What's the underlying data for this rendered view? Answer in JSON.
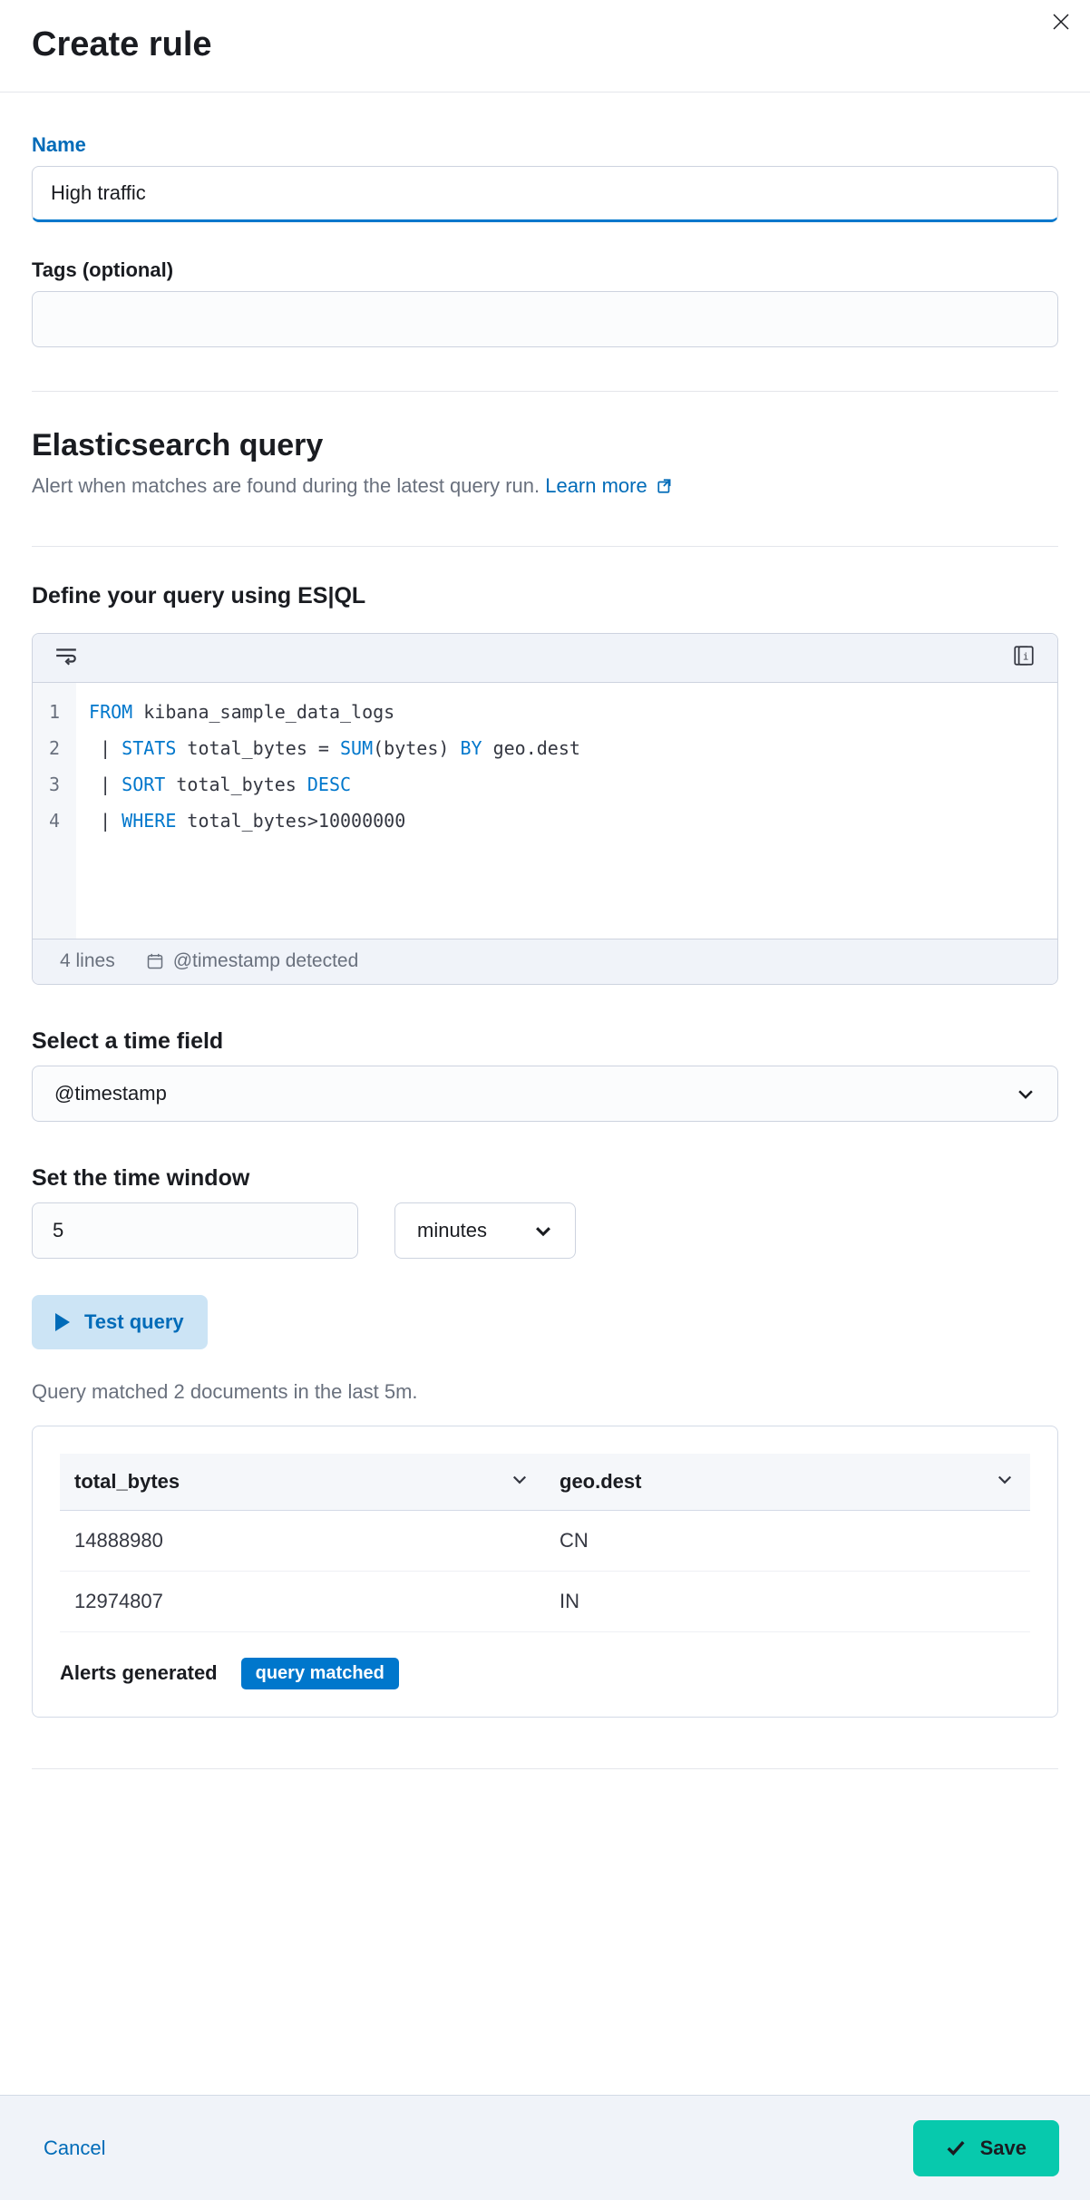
{
  "header": {
    "title": "Create rule"
  },
  "form": {
    "name_label": "Name",
    "name_value": "High traffic",
    "tags_label": "Tags (optional)"
  },
  "query_section": {
    "title": "Elasticsearch query",
    "subtitle": "Alert when matches are found during the latest query run. ",
    "learn_more": "Learn more"
  },
  "define_query": {
    "heading": "Define your query using ES|QL",
    "lines": [
      "1",
      "2",
      "3",
      "4"
    ],
    "code": {
      "l1_kw": "FROM",
      "l1_rest": " kibana_sample_data_logs",
      "l2_pipe": " | ",
      "l2_kw": "STATS",
      "l2_mid": " total_bytes = ",
      "l2_fn": "SUM",
      "l2_after": "(bytes) ",
      "l2_by": "BY",
      "l2_rest": " geo.dest",
      "l3_pipe": " | ",
      "l3_kw": "SORT",
      "l3_rest": " total_bytes ",
      "l3_dir": "DESC",
      "l4_pipe": " | ",
      "l4_kw": "WHERE",
      "l4_rest": " total_bytes>10000000"
    },
    "footer_lines": "4 lines",
    "footer_detected": "@timestamp detected"
  },
  "time_field": {
    "heading": "Select a time field",
    "value": "@timestamp"
  },
  "time_window": {
    "heading": "Set the time window",
    "value": "5",
    "unit": "minutes"
  },
  "test": {
    "button": "Test query",
    "result": "Query matched 2 documents in the last 5m."
  },
  "results": {
    "columns": [
      "total_bytes",
      "geo.dest"
    ],
    "rows": [
      {
        "total_bytes": "14888980",
        "geo_dest": "CN"
      },
      {
        "total_bytes": "12974807",
        "geo_dest": "IN"
      }
    ],
    "alerts_label": "Alerts generated",
    "alerts_badge": "query matched"
  },
  "footer": {
    "cancel": "Cancel",
    "save": "Save"
  }
}
